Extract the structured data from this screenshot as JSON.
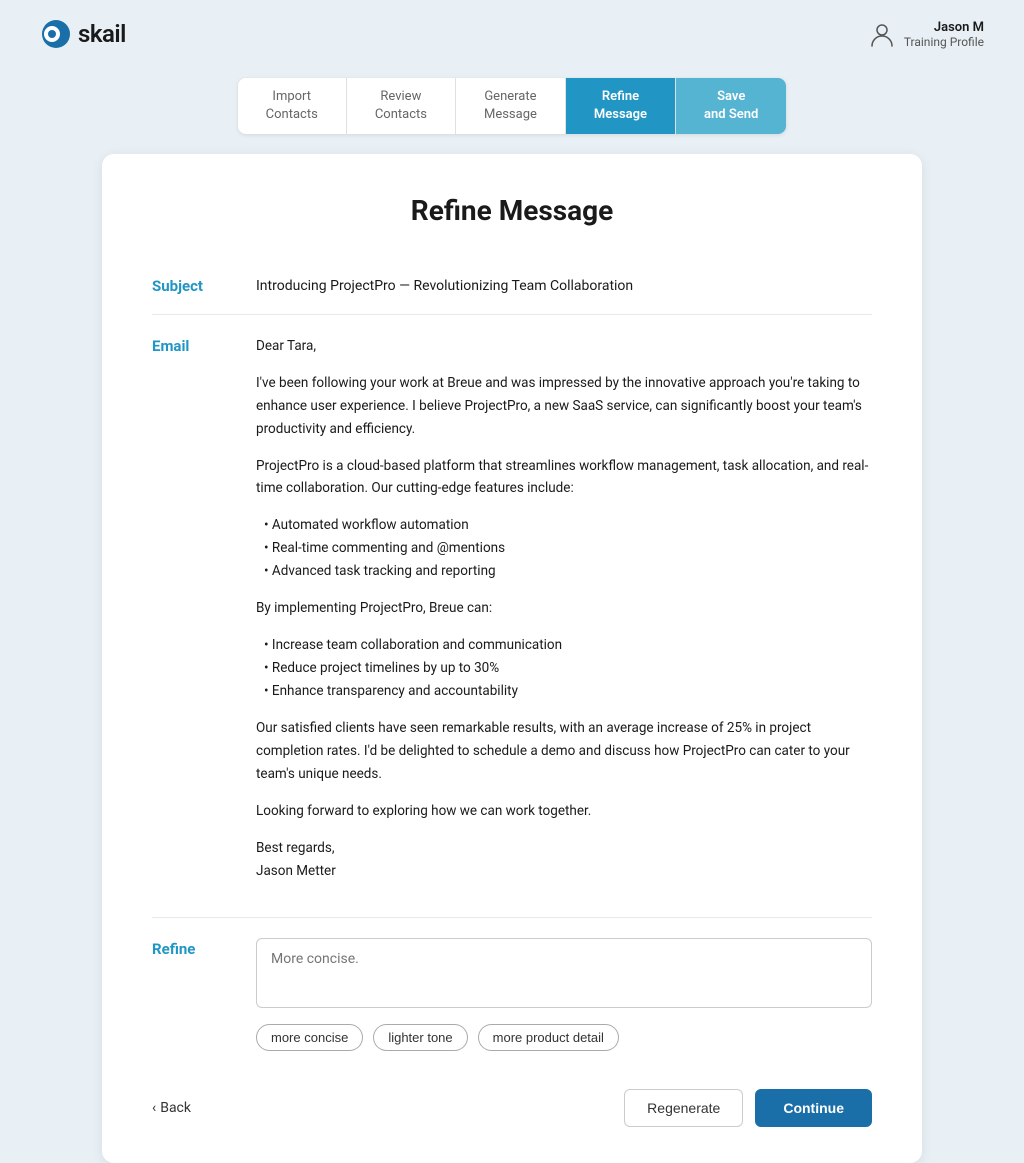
{
  "header": {
    "logo_text": "skail",
    "user_name": "Jason M",
    "user_role": "Training Profile"
  },
  "steps": [
    {
      "id": "import-contacts",
      "label": "Import\nContacts",
      "state": "inactive"
    },
    {
      "id": "review-contacts",
      "label": "Review\nContacts",
      "state": "inactive"
    },
    {
      "id": "generate-message",
      "label": "Generate\nMessage",
      "state": "inactive"
    },
    {
      "id": "refine-message",
      "label": "Refine\nMessage",
      "state": "active"
    },
    {
      "id": "save-and-send",
      "label": "Save\nand Send",
      "state": "next-active"
    }
  ],
  "card": {
    "title": "Refine Message",
    "subject_label": "Subject",
    "subject_text": "Introducing ProjectPro — Revolutionizing Team Collaboration",
    "email_label": "Email",
    "email_body": {
      "greeting": "Dear Tara,",
      "paragraph1": "I've been following your work at Breue and was impressed by the innovative approach you're taking to enhance user experience. I believe ProjectPro, a new SaaS service, can significantly boost your team's productivity and efficiency.",
      "paragraph2": "ProjectPro is a cloud-based platform that streamlines workflow management, task allocation, and real-time collaboration. Our cutting-edge features include:",
      "features": [
        "Automated workflow automation",
        "Real-time commenting and @mentions",
        "Advanced task tracking and reporting"
      ],
      "paragraph3": "By implementing ProjectPro, Breue can:",
      "benefits": [
        "Increase team collaboration and communication",
        "Reduce project timelines by up to 30%",
        "Enhance transparency and accountability"
      ],
      "paragraph4": "Our satisfied clients have seen remarkable results, with an average increase of 25% in project completion rates. I'd be delighted to schedule a demo and discuss how ProjectPro can cater to your team's unique needs.",
      "paragraph5": "Looking forward to exploring how we can work together.",
      "closing": "Best regards,",
      "sender": "Jason Metter"
    },
    "refine_label": "Refine",
    "refine_placeholder": "More concise.",
    "chips": [
      "more concise",
      "lighter tone",
      "more product detail"
    ],
    "back_label": "Back",
    "regenerate_label": "Regenerate",
    "continue_label": "Continue"
  }
}
